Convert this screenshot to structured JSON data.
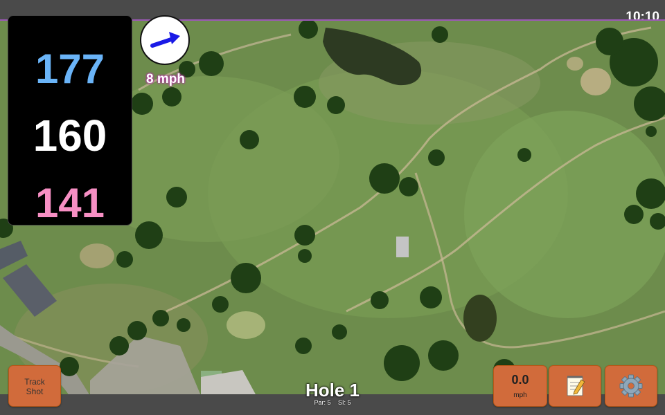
{
  "status_bar": {
    "time": "10:10"
  },
  "distances": {
    "back": "177",
    "middle": "160",
    "front": "141"
  },
  "wind": {
    "speed": "8 mph",
    "icon": "wind-direction-arrow-icon"
  },
  "hole": {
    "title": "Hole 1",
    "par": "Par: 5",
    "stroke_index": "SI: 5"
  },
  "buttons": {
    "track_shot": {
      "line1": "Track",
      "line2": "Shot"
    },
    "speed": {
      "value": "0.0",
      "unit": "mph"
    },
    "notes_icon": "notepad-icon",
    "settings_icon": "gear-icon"
  },
  "colors": {
    "back_distance": "#6ab4f8",
    "middle_distance": "#ffffff",
    "front_distance": "#f78fc4",
    "button": "#d16b3b",
    "wind_arrow": "#1a1ae6"
  }
}
